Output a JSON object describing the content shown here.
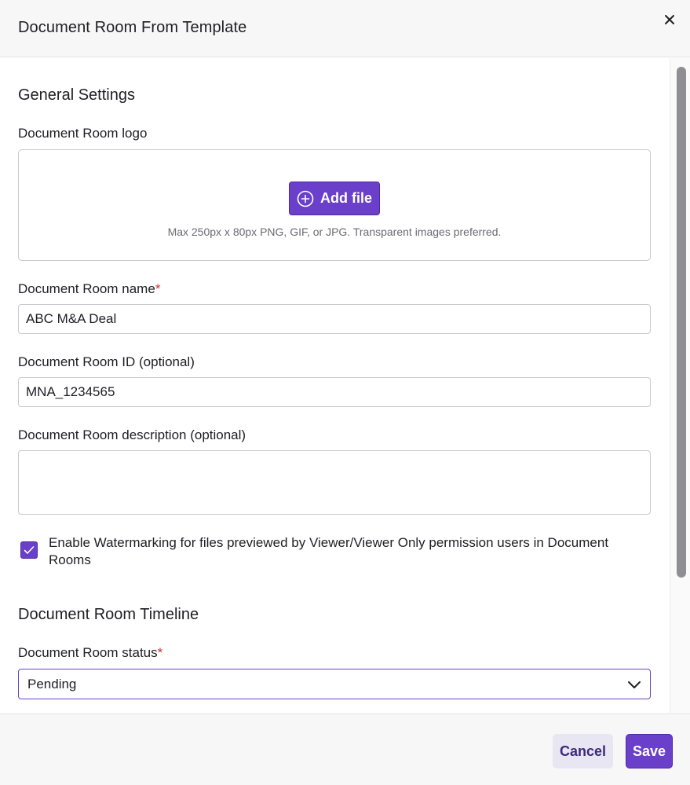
{
  "dialog": {
    "title": "Document Room From Template",
    "close_icon": "close-icon"
  },
  "general": {
    "section_title": "General Settings",
    "logo": {
      "label": "Document Room logo",
      "add_file_label": "Add file",
      "add_icon": "plus-circle-icon",
      "hint": "Max 250px x 80px PNG, GIF, or JPG. Transparent images preferred."
    },
    "name": {
      "label": "Document Room name",
      "required_mark": "*",
      "value": "ABC M&A Deal"
    },
    "room_id": {
      "label": "Document Room ID (optional)",
      "value": "MNA_1234565"
    },
    "description": {
      "label": "Document Room description (optional)",
      "value": ""
    },
    "watermark": {
      "checked": true,
      "label": "Enable Watermarking for files previewed by Viewer/Viewer Only permission users in Document Rooms"
    }
  },
  "timeline": {
    "section_title": "Document Room Timeline",
    "status": {
      "label": "Document Room status",
      "required_mark": "*",
      "selected": "Pending"
    }
  },
  "footer": {
    "cancel_label": "Cancel",
    "save_label": "Save"
  },
  "colors": {
    "accent": "#6a3fc9",
    "required": "#d0302c",
    "cancel_bg": "#e8e6f3"
  }
}
